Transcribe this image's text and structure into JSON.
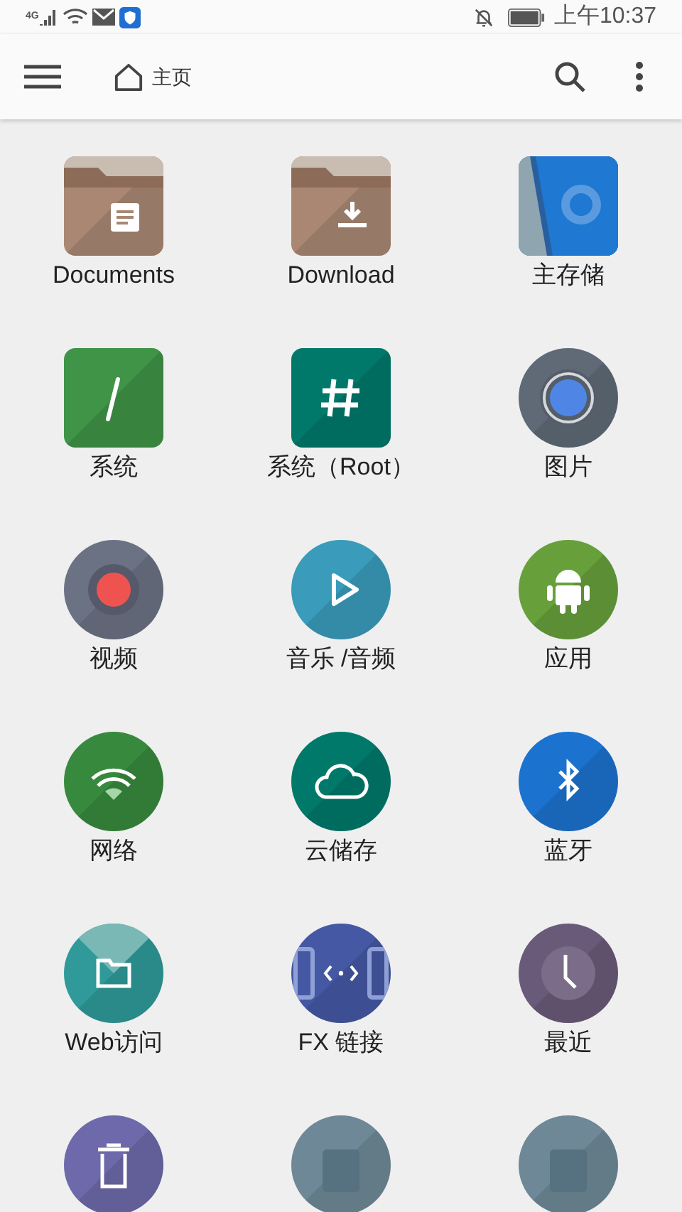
{
  "status_bar": {
    "network": "4G",
    "time": "上午10:37"
  },
  "toolbar": {
    "title": "主页"
  },
  "tiles": [
    {
      "label": "Documents",
      "kind": "square",
      "color": "#a98773"
    },
    {
      "label": "Download",
      "kind": "square",
      "color": "#a98773"
    },
    {
      "label": "主存储",
      "kind": "square",
      "color": "#1f78d1"
    },
    {
      "label": "系统",
      "kind": "square",
      "color": "#3f9447"
    },
    {
      "label": "系统（Root）",
      "kind": "square",
      "color": "#00796b"
    },
    {
      "label": "图片",
      "kind": "circle",
      "color": "#5f6a76"
    },
    {
      "label": "视频",
      "kind": "circle",
      "color": "#6b7283"
    },
    {
      "label": "音乐 /音频",
      "kind": "circle",
      "color": "#3a9bbb"
    },
    {
      "label": "应用",
      "kind": "circle",
      "color": "#67a03b"
    },
    {
      "label": "网络",
      "kind": "circle",
      "color": "#378a3d"
    },
    {
      "label": "云储存",
      "kind": "circle",
      "color": "#00796b"
    },
    {
      "label": "蓝牙",
      "kind": "circle",
      "color": "#1c72cf"
    },
    {
      "label": "Web访问",
      "kind": "circle",
      "color": "#2f9a99"
    },
    {
      "label": "FX 链接",
      "kind": "circle",
      "color": "#4458a3"
    },
    {
      "label": "最近",
      "kind": "circle",
      "color": "#6a5a79"
    },
    {
      "kind": "circle",
      "color": "#6d69aa"
    },
    {
      "kind": "circle",
      "color": "#6f8897"
    },
    {
      "kind": "circle",
      "color": "#6f8897"
    }
  ]
}
